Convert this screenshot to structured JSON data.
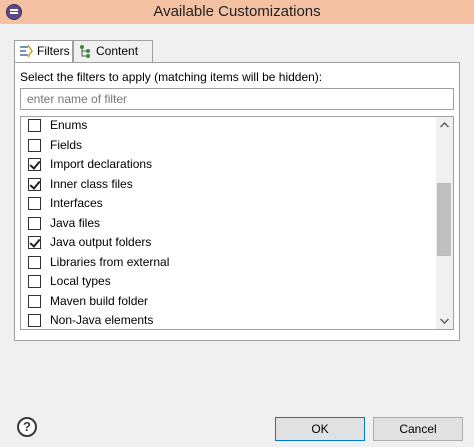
{
  "window": {
    "title": "Available Customizations"
  },
  "tabs": [
    {
      "label": "Filters",
      "icon": "filters-icon",
      "active": true
    },
    {
      "label": "Content",
      "icon": "content-tree-icon",
      "active": false
    }
  ],
  "filters": {
    "instruction": "Select the filters to apply (matching items will be hidden):",
    "search_placeholder": "enter name of filter",
    "items": [
      {
        "label": "Enums",
        "checked": false
      },
      {
        "label": "Fields",
        "checked": false
      },
      {
        "label": "Import declarations",
        "checked": true
      },
      {
        "label": "Inner class files",
        "checked": true
      },
      {
        "label": "Interfaces",
        "checked": false
      },
      {
        "label": "Java files",
        "checked": false
      },
      {
        "label": "Java output folders",
        "checked": true
      },
      {
        "label": "Libraries from external",
        "checked": false
      },
      {
        "label": "Local types",
        "checked": false
      },
      {
        "label": "Maven build folder",
        "checked": false
      },
      {
        "label": "Non-Java elements",
        "checked": false
      }
    ]
  },
  "buttons": {
    "help": "?",
    "ok": "OK",
    "cancel": "Cancel"
  }
}
